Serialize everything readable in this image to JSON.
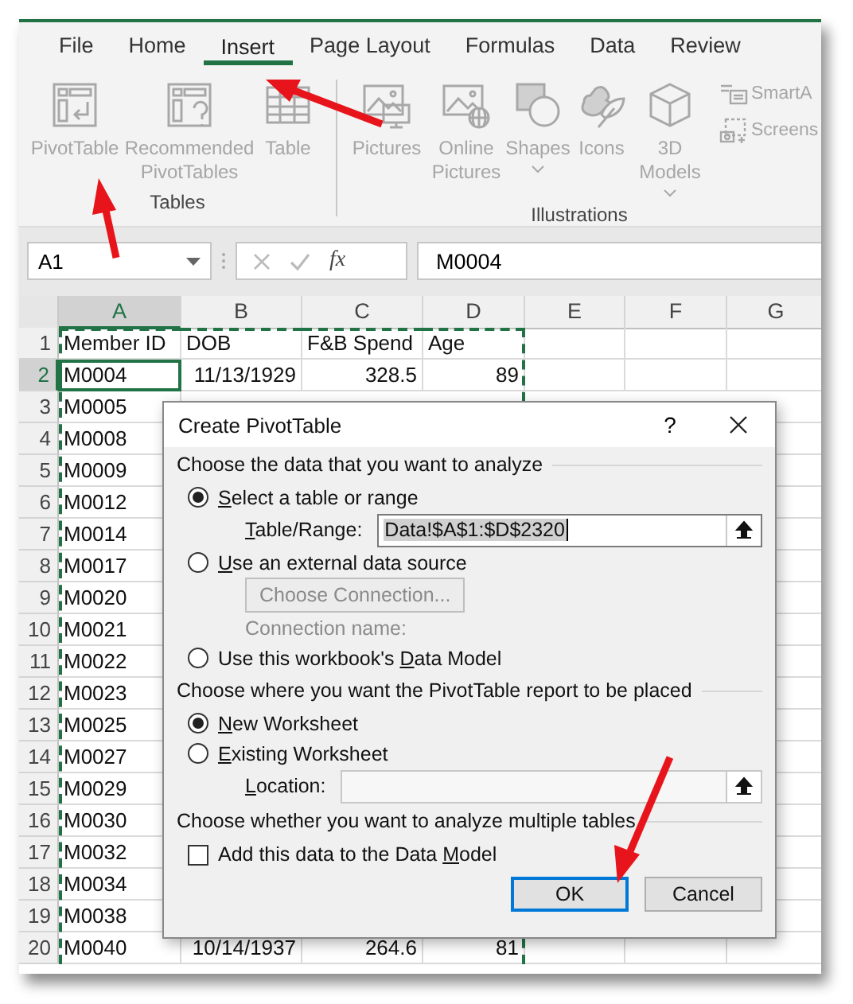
{
  "ribbon_tabs": [
    {
      "label": "File",
      "selected": false
    },
    {
      "label": "Home",
      "selected": false
    },
    {
      "label": "Insert",
      "selected": true
    },
    {
      "label": "Page Layout",
      "selected": false
    },
    {
      "label": "Formulas",
      "selected": false
    },
    {
      "label": "Data",
      "selected": false
    },
    {
      "label": "Review",
      "selected": false
    }
  ],
  "ribbon_groups": [
    {
      "label": "Tables",
      "buttons": [
        {
          "kind": "pivot",
          "label": "PivotTable",
          "disabled": true,
          "dropdown": false
        },
        {
          "kind": "recommended",
          "label": "Recommended PivotTables",
          "disabled": true,
          "dropdown": false
        },
        {
          "kind": "table",
          "label": "Table",
          "disabled": true,
          "dropdown": false
        }
      ]
    },
    {
      "label": "Illustrations",
      "buttons": [
        {
          "kind": "pictures",
          "label": "Pictures",
          "disabled": true,
          "dropdown": false
        },
        {
          "kind": "online",
          "label": "Online Pictures",
          "disabled": true,
          "dropdown": false
        },
        {
          "kind": "shapes",
          "label": "Shapes",
          "disabled": true,
          "dropdown": true
        },
        {
          "kind": "icons",
          "label": "Icons",
          "disabled": true,
          "dropdown": false
        },
        {
          "kind": "cube",
          "label": "3D Models",
          "disabled": true,
          "dropdown": true
        }
      ],
      "small_buttons": [
        {
          "kind": "smartart",
          "label": "SmartA",
          "disabled": true
        },
        {
          "kind": "screenshot",
          "label": "Screens",
          "disabled": true
        }
      ]
    }
  ],
  "formula_bar": {
    "name_box": "A1",
    "function_label": "fx",
    "value": "M0004"
  },
  "sheet": {
    "columns": [
      {
        "label": "A",
        "selected": true,
        "in_copy_range": true,
        "kind": "text"
      },
      {
        "label": "B",
        "selected": false,
        "in_copy_range": true,
        "kind": "number"
      },
      {
        "label": "C",
        "selected": false,
        "in_copy_range": true,
        "kind": "number"
      },
      {
        "label": "D",
        "selected": false,
        "in_copy_range": true,
        "kind": "number"
      },
      {
        "label": "E",
        "selected": false,
        "in_copy_range": false,
        "kind": "text"
      },
      {
        "label": "F",
        "selected": false,
        "in_copy_range": false,
        "kind": "text"
      },
      {
        "label": "G",
        "selected": false,
        "in_copy_range": false,
        "kind": "text"
      }
    ],
    "rows": [
      {
        "header": "1",
        "kind": "header",
        "selected": false,
        "cells": [
          "Member ID",
          "DOB",
          "F&B Spend",
          "Age"
        ]
      },
      {
        "header": "2",
        "kind": "data",
        "selected": true,
        "cells": [
          "M0004",
          "11/13/1929",
          "328.5",
          "89"
        ]
      },
      {
        "header": "3",
        "kind": "data",
        "selected": false,
        "cells": [
          "M0005"
        ]
      },
      {
        "header": "4",
        "kind": "data",
        "selected": false,
        "cells": [
          "M0008"
        ]
      },
      {
        "header": "5",
        "kind": "data",
        "selected": false,
        "cells": [
          "M0009"
        ]
      },
      {
        "header": "6",
        "kind": "data",
        "selected": false,
        "cells": [
          "M0012"
        ]
      },
      {
        "header": "7",
        "kind": "data",
        "selected": false,
        "cells": [
          "M0014"
        ]
      },
      {
        "header": "8",
        "kind": "data",
        "selected": false,
        "cells": [
          "M0017"
        ]
      },
      {
        "header": "9",
        "kind": "data",
        "selected": false,
        "cells": [
          "M0020"
        ]
      },
      {
        "header": "10",
        "kind": "data",
        "selected": false,
        "cells": [
          "M0021"
        ]
      },
      {
        "header": "11",
        "kind": "data",
        "selected": false,
        "cells": [
          "M0022"
        ]
      },
      {
        "header": "12",
        "kind": "data",
        "selected": false,
        "cells": [
          "M0023"
        ]
      },
      {
        "header": "13",
        "kind": "data",
        "selected": false,
        "cells": [
          "M0025"
        ]
      },
      {
        "header": "14",
        "kind": "data",
        "selected": false,
        "cells": [
          "M0027"
        ]
      },
      {
        "header": "15",
        "kind": "data",
        "selected": false,
        "cells": [
          "M0029"
        ]
      },
      {
        "header": "16",
        "kind": "data",
        "selected": false,
        "cells": [
          "M0030"
        ]
      },
      {
        "header": "17",
        "kind": "data",
        "selected": false,
        "cells": [
          "M0032"
        ]
      },
      {
        "header": "18",
        "kind": "data",
        "selected": false,
        "cells": [
          "M0034"
        ]
      },
      {
        "header": "19",
        "kind": "data",
        "selected": false,
        "cells": [
          "M0038"
        ]
      },
      {
        "header": "20",
        "kind": "data",
        "selected": false,
        "cells": [
          "M0040",
          "10/14/1937",
          "264.6",
          "81"
        ]
      }
    ]
  },
  "dialog": {
    "title": "Create PivotTable",
    "help": "?",
    "sections": [
      {
        "heading": "Choose the data that you want to analyze",
        "items": [
          {
            "kind": "radio",
            "label": {
              "key": "S",
              "after": "elect a table or range"
            },
            "selected": true
          },
          {
            "kind": "field",
            "label": {
              "key": "T",
              "after": "able/Range:"
            },
            "value": "Data!$A$1:$D$2320",
            "text_selected": true,
            "disabled": false
          },
          {
            "kind": "radio",
            "label": {
              "key": "U",
              "after": "se an external data source"
            },
            "selected": false
          },
          {
            "kind": "button",
            "label": "Choose Connection...",
            "disabled": true
          },
          {
            "kind": "note",
            "label": "Connection name:",
            "disabled": true
          },
          {
            "kind": "radio",
            "label": {
              "before": "Use this workbook's ",
              "key": "D",
              "after": "ata Model"
            },
            "selected": false
          }
        ]
      },
      {
        "heading": "Choose where you want the PivotTable report to be placed",
        "items": [
          {
            "kind": "radio",
            "label": {
              "key": "N",
              "after": "ew Worksheet"
            },
            "selected": true
          },
          {
            "kind": "radio",
            "label": {
              "key": "E",
              "after": "xisting Worksheet"
            },
            "selected": false
          },
          {
            "kind": "field",
            "label": {
              "key": "L",
              "after": "ocation:"
            },
            "disabled": true
          }
        ]
      },
      {
        "heading": "Choose whether you want to analyze multiple tables",
        "items": [
          {
            "kind": "checkbox",
            "label": {
              "before": "Add this data to the Data ",
              "key": "M",
              "after": "odel"
            },
            "checked": false
          }
        ]
      }
    ],
    "buttons": [
      {
        "label": "OK",
        "focused": true
      },
      {
        "label": "Cancel",
        "focused": false
      }
    ]
  }
}
